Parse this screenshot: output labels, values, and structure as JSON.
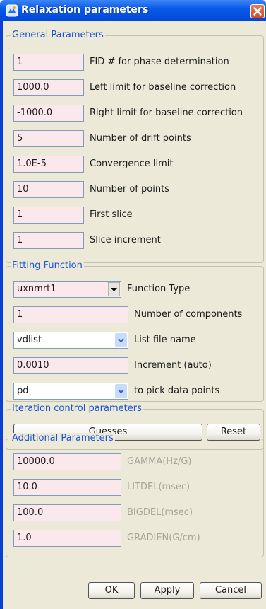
{
  "window": {
    "title": "Relaxation parameters"
  },
  "general": {
    "legend": "General Parameters",
    "rows": [
      {
        "value": "1",
        "label": "FID # for phase determination"
      },
      {
        "value": "1000.0",
        "label": "Left limit for baseline correction"
      },
      {
        "value": "-1000.0",
        "label": "Right limit for baseline correction"
      },
      {
        "value": "5",
        "label": "Number of drift points"
      },
      {
        "value": "1.0E-5",
        "label": "Convergence limit"
      },
      {
        "value": "10",
        "label": "Number of points"
      },
      {
        "value": "1",
        "label": "First slice"
      },
      {
        "value": "1",
        "label": "Slice increment"
      }
    ]
  },
  "fitting": {
    "legend": "Fitting Function",
    "function_type": {
      "value": "uxnmrt1",
      "label": "Function Type"
    },
    "components": {
      "value": "1",
      "label": "Number of components"
    },
    "list_file": {
      "value": "vdlist",
      "label": "List file name"
    },
    "increment": {
      "value": "0.0010",
      "label": "Increment (auto)"
    },
    "pick": {
      "value": "pd",
      "label": "to pick data points"
    }
  },
  "iteration": {
    "legend": "Iteration control parameters",
    "guesses_label": "Guesses",
    "reset_label": "Reset"
  },
  "additional": {
    "legend": "Additional Parameters",
    "rows": [
      {
        "value": "10000.0",
        "label": "GAMMA(Hz/G)"
      },
      {
        "value": "10.0",
        "label": "LITDEL(msec)"
      },
      {
        "value": "100.0",
        "label": "BIGDEL(msec)"
      },
      {
        "value": "1.0",
        "label": "GRADIEN(G/cm)"
      }
    ]
  },
  "footer": {
    "ok_label": "OK",
    "apply_label": "Apply",
    "cancel_label": "Cancel"
  },
  "icons": {
    "app": "app-icon",
    "close": "close-icon",
    "dropdown": "chevron-down-icon"
  },
  "colors": {
    "title_bar": "#0a5ae8",
    "legend_text": "#1b52d7",
    "field_background": "#fbe8ec",
    "close_button": "#d24a25",
    "panel": "#ece9d8"
  }
}
